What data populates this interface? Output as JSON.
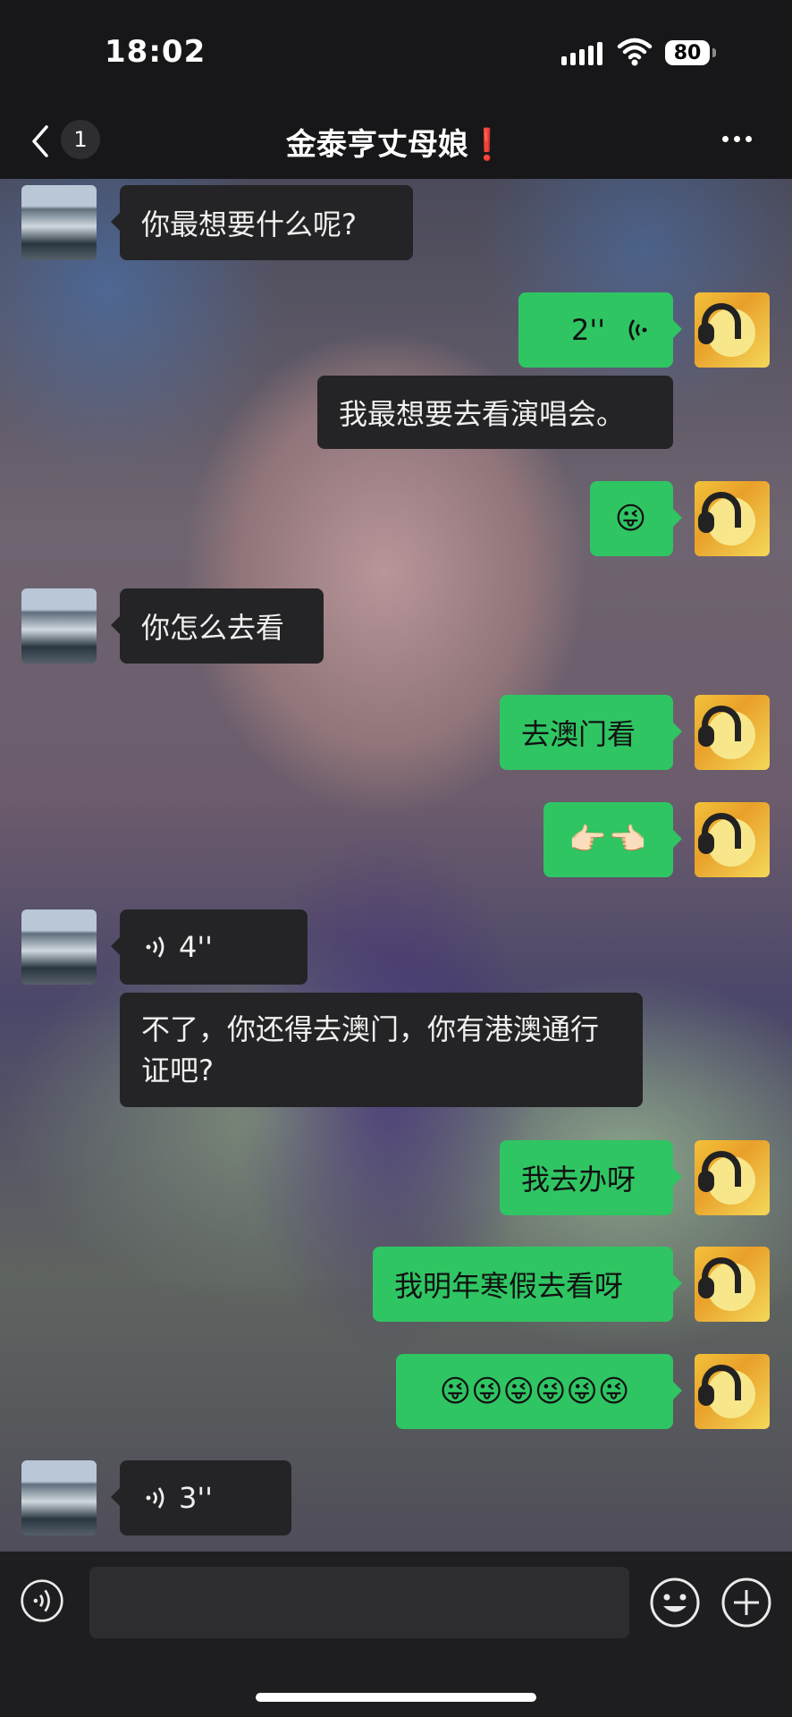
{
  "status_bar": {
    "time": "18:02",
    "battery": "80"
  },
  "header": {
    "unread_count": "1",
    "title": "金泰亨丈母娘❗"
  },
  "messages": [
    {
      "side": "left",
      "type": "text",
      "text": "你最想要什么呢?"
    },
    {
      "side": "right",
      "type": "voice",
      "duration": "2''"
    },
    {
      "side": "right",
      "type": "text_plain",
      "text": "我最想要去看演唱会。"
    },
    {
      "side": "right",
      "type": "text",
      "text": "😜"
    },
    {
      "side": "left",
      "type": "text",
      "text": "你怎么去看"
    },
    {
      "side": "right",
      "type": "text",
      "text": "去澳门看"
    },
    {
      "side": "right",
      "type": "text",
      "text": "👉🏻👈🏻"
    },
    {
      "side": "left",
      "type": "voice",
      "duration": "4''"
    },
    {
      "side": "left",
      "type": "text_plain",
      "text": "不了，你还得去澳门，你有港澳通行证吧?"
    },
    {
      "side": "right",
      "type": "text",
      "text": "我去办呀"
    },
    {
      "side": "right",
      "type": "text",
      "text": "我明年寒假去看呀"
    },
    {
      "side": "right",
      "type": "text",
      "text": "😜😜😜😜😜😜"
    },
    {
      "side": "left",
      "type": "voice",
      "duration": "3''"
    }
  ],
  "input": {
    "placeholder": ""
  },
  "colors": {
    "sent_bubble": "#2fc563",
    "received_bubble": "#242426",
    "bar": "#171719"
  },
  "icons": [
    "back-icon",
    "more-icon",
    "voice-wave-icon",
    "voice-input-icon",
    "emoji-icon",
    "plus-icon"
  ]
}
